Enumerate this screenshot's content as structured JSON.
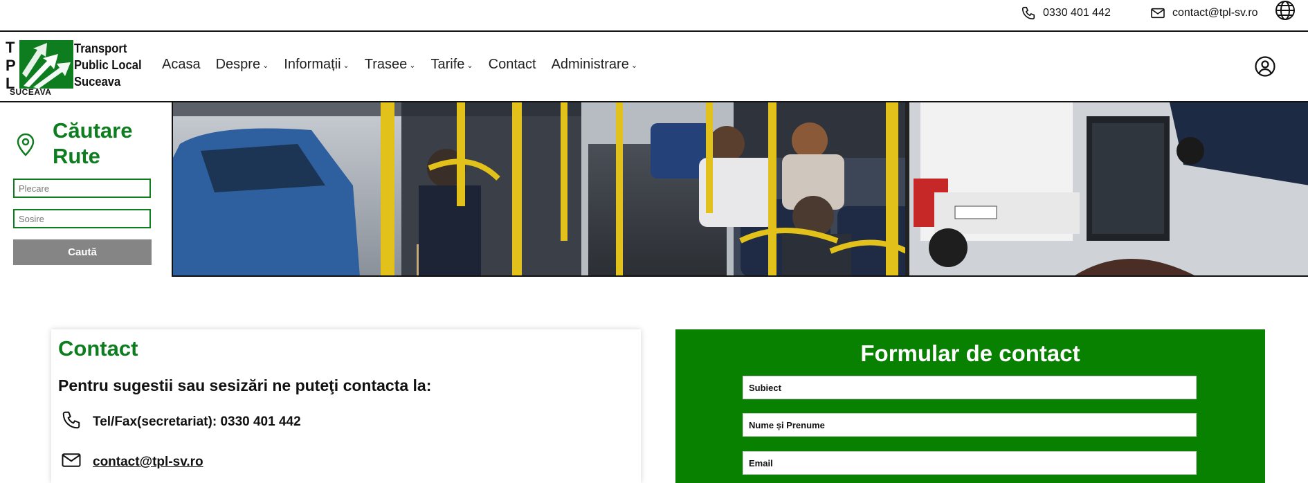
{
  "topbar": {
    "phone": "0330 401 442",
    "email": "contact@tpl-sv.ro",
    "icons": [
      "phone-icon",
      "mail-icon",
      "globe-icon"
    ]
  },
  "logo": {
    "letters": [
      "T",
      "P",
      "L"
    ],
    "subtitle": "SUCEAVA",
    "name_lines": [
      "Transport",
      "Public Local",
      "Suceava"
    ],
    "color": "#0d7d1f"
  },
  "nav": {
    "items": [
      {
        "label": "Acasa",
        "dropdown": false
      },
      {
        "label": "Despre",
        "dropdown": true
      },
      {
        "label": "Informații",
        "dropdown": true
      },
      {
        "label": "Trasee",
        "dropdown": true
      },
      {
        "label": "Tarife",
        "dropdown": true
      },
      {
        "label": "Contact",
        "dropdown": false
      },
      {
        "label": "Administrare",
        "dropdown": true
      }
    ]
  },
  "search": {
    "title_line1": "Căutare",
    "title_line2": "Rute",
    "departure_placeholder": "Plecare",
    "arrival_placeholder": "Sosire",
    "button_label": "Caută"
  },
  "contact": {
    "title": "Contact",
    "subtitle": "Pentru sugestii sau sesizări ne puteţi contacta la:",
    "phone_label": "Tel/Fax(secretariat): 0330 401 442",
    "email_label": "contact@tpl-sv.ro"
  },
  "form": {
    "title": "Formular de contact",
    "subject_placeholder": "Subiect",
    "name_placeholder": "Nume și Prenume",
    "email_placeholder": "Email"
  },
  "colors": {
    "brand_green": "#0d7d1f",
    "form_green": "#088000",
    "button_gray": "#858585"
  }
}
